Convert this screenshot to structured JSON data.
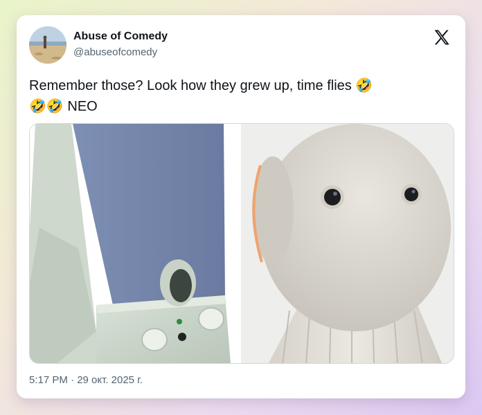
{
  "tweet": {
    "author_name": "Abuse of Comedy",
    "author_handle": "@abuseofcomedy",
    "text_line1": "Remember those? Look how they grew up, time flies",
    "text_line2_suffix": " NEO",
    "emoji": "🤣",
    "timestamp": "5:17 PM · 29 окт. 2025 г."
  },
  "icons": {
    "brand": "x-logo-icon",
    "avatar": "beach-avatar"
  },
  "media": {
    "images": [
      {
        "name": "desktop-speaker-photo"
      },
      {
        "name": "robot-head-photo"
      }
    ]
  },
  "colors": {
    "text": "#0f1419",
    "secondary_text": "#536471",
    "card_bg": "#ffffff"
  }
}
